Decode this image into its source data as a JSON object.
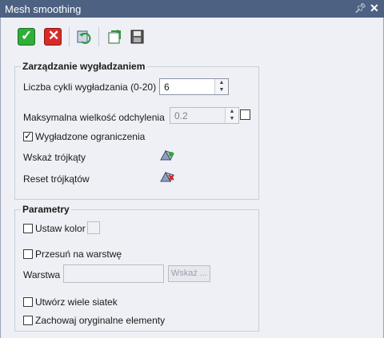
{
  "window": {
    "title": "Mesh smoothing"
  },
  "toolbar": {
    "ok_icon": "check-icon",
    "cancel_icon": "x-icon",
    "refresh_icon": "refresh-icon",
    "export_icon": "export-icon",
    "save_icon": "save-icon"
  },
  "smoothing": {
    "legend": "Zarządzanie wygładzaniem",
    "cycles_label": "Liczba cykli wygładzania (0-20)",
    "cycles_value": "6",
    "max_dev_label": "Maksymalna wielkość odchylenia",
    "max_dev_value": "0.2",
    "smoothed_constraints_label": "Wygładzone ograniczenia",
    "smoothed_constraints_checked": true,
    "max_dev_checked": false,
    "select_triangles_label": "Wskaż trójkąty",
    "reset_triangles_label": "Reset trójkątów"
  },
  "params": {
    "legend": "Parametry",
    "set_color_label": "Ustaw kolor",
    "move_layer_label": "Przesuń na warstwę",
    "layer_label": "Warstwa",
    "layer_value": "",
    "select_button": "Wskaż ...",
    "multi_mesh_label": "Utwórz wiele siatek",
    "keep_original_label": "Zachowaj oryginalne elementy"
  }
}
